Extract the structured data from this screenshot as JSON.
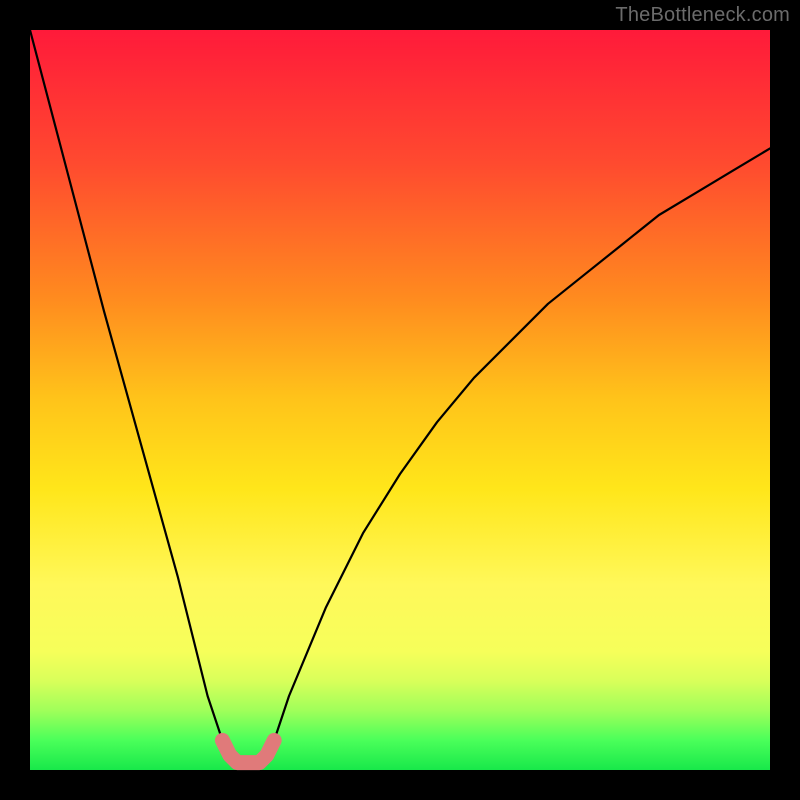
{
  "watermark": "TheBottleneck.com",
  "chart_data": {
    "type": "line",
    "title": "",
    "xlabel": "",
    "ylabel": "",
    "xlim": [
      0,
      100
    ],
    "ylim": [
      0,
      100
    ],
    "grid": false,
    "legend": false,
    "series": [
      {
        "name": "bottleneck-curve",
        "color": "#000000",
        "x": [
          0,
          5,
          10,
          15,
          20,
          24,
          26,
          27,
          28,
          29,
          30,
          31,
          32,
          33,
          35,
          40,
          45,
          50,
          55,
          60,
          65,
          70,
          75,
          80,
          85,
          90,
          95,
          100
        ],
        "values": [
          100,
          81,
          62,
          44,
          26,
          10,
          4,
          2,
          1,
          1,
          1,
          1,
          2,
          4,
          10,
          22,
          32,
          40,
          47,
          53,
          58,
          63,
          67,
          71,
          75,
          78,
          81,
          84
        ]
      },
      {
        "name": "optimal-zone-marker",
        "color": "#e07a7a",
        "x": [
          26,
          27,
          28,
          29,
          30,
          31,
          32,
          33
        ],
        "values": [
          4,
          2,
          1,
          1,
          1,
          1,
          2,
          4
        ]
      }
    ]
  },
  "colors": {
    "frame": "#000000",
    "curve": "#000000",
    "marker": "#e07a7a",
    "watermark": "#6b6b6b"
  }
}
